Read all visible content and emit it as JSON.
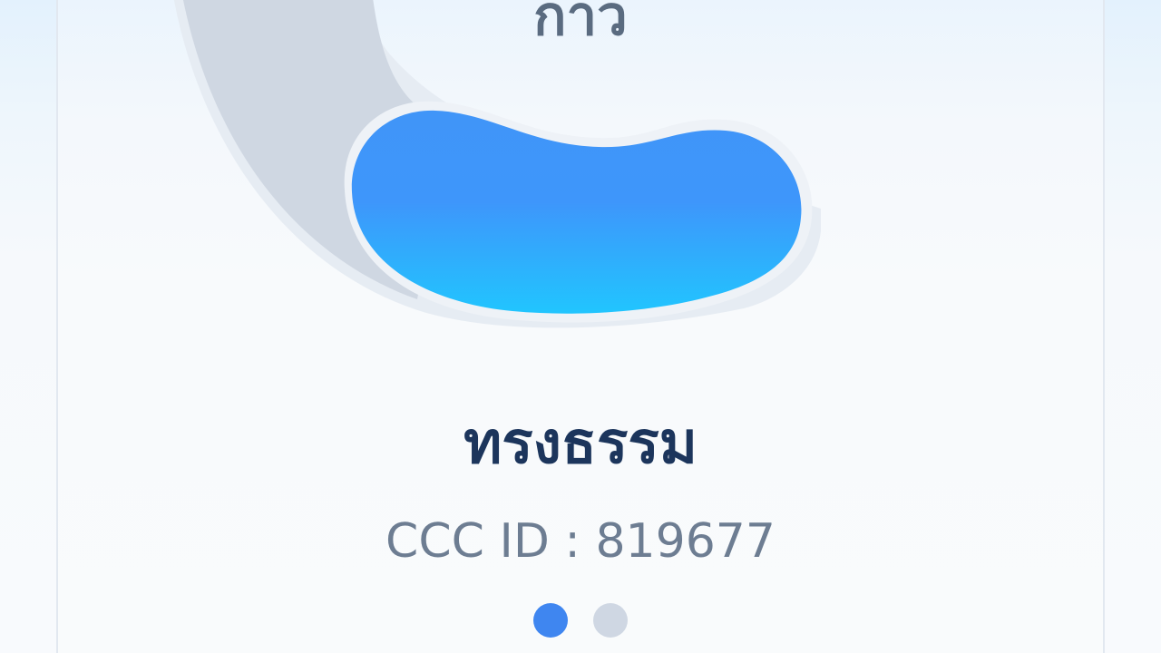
{
  "header": {
    "title": "กาว"
  },
  "profile": {
    "name": "ทรงธรรม",
    "id_text": "CCC ID : 819677"
  },
  "pagination": {
    "total_pages": 2,
    "active_page": 1
  },
  "colors": {
    "active_dot": "#3f86f0",
    "inactive_dot": "#cfd7e3",
    "name_text": "#1c355c",
    "id_text": "#6d7d92",
    "blob_top": "#4393f8",
    "blob_bottom": "#22c2fd",
    "arc_gray": "#cfd7e2"
  },
  "icons": {
    "illustration": "crescent-blob-illustration"
  }
}
